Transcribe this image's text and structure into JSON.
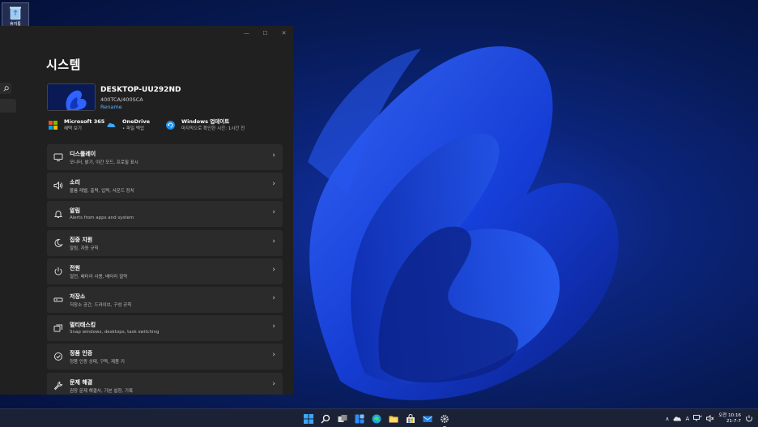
{
  "desktop": {
    "recycle_bin_label": "휴지통"
  },
  "window": {
    "controls": {
      "minimize": "—",
      "maximize": "☐",
      "close": "✕"
    },
    "page_title": "시스템",
    "device": {
      "name": "DESKTOP-UU292ND",
      "model": "400TCA/400SCA",
      "rename_label": "Rename"
    },
    "quick_links": [
      {
        "title": "Microsoft 365",
        "subtitle": "혜택 보기",
        "icon": "microsoft-365-icon"
      },
      {
        "title": "OneDrive",
        "subtitle": "• 파일 백업",
        "icon": "onedrive-icon"
      },
      {
        "title": "Windows 업데이트",
        "subtitle": "마지막으로 확인한 시간: 1시간 전",
        "icon": "windows-update-icon"
      }
    ],
    "settings": [
      {
        "title": "디스플레이",
        "subtitle": "모니터, 밝기, 야간 모드, 프로필 표시",
        "icon": "display-icon"
      },
      {
        "title": "소리",
        "subtitle": "볼륨 레벨, 출력, 입력, 사운드 장치",
        "icon": "sound-icon"
      },
      {
        "title": "알림",
        "subtitle": "Alerts from apps and system",
        "icon": "notification-icon"
      },
      {
        "title": "집중 지원",
        "subtitle": "알림, 자동 규칙",
        "icon": "focus-assist-icon"
      },
      {
        "title": "전원",
        "subtitle": "절전, 배터리 사용, 배터리 절약",
        "icon": "power-icon"
      },
      {
        "title": "저장소",
        "subtitle": "저장소 공간, 드라이브, 구성 규칙",
        "icon": "storage-icon"
      },
      {
        "title": "멀티태스킹",
        "subtitle": "Snap windows, desktops, task switching",
        "icon": "multitasking-icon"
      },
      {
        "title": "정품 인증",
        "subtitle": "정품 인증 상태, 구독, 제품 키",
        "icon": "activation-icon"
      },
      {
        "title": "문제 해결",
        "subtitle": "권장 문제 해결사, 기본 설정, 기록",
        "icon": "troubleshoot-icon"
      }
    ],
    "chevron": "›"
  },
  "taskbar": {
    "apps": [
      "start-icon",
      "search-icon",
      "task-view-icon",
      "widgets-icon",
      "edge-icon",
      "file-explorer-icon",
      "store-icon",
      "mail-icon",
      "settings-icon"
    ],
    "tray": {
      "chevron": "∧",
      "ime": "A",
      "time_top": "오전 10:16",
      "time_bottom": "21-7-7"
    }
  },
  "colors": {
    "accent": "#60b0ff",
    "window_bg": "#202020",
    "card_bg": "#2b2b2b",
    "taskbar_bg": "#1c2236"
  }
}
